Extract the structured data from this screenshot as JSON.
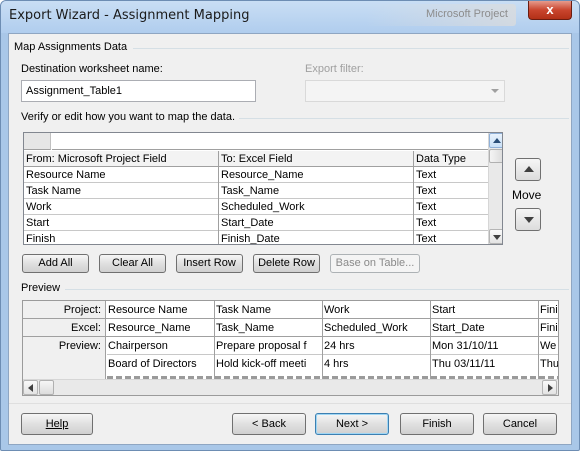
{
  "window": {
    "title": "Export Wizard - Assignment Mapping",
    "ghost_title": "Microsoft Project",
    "close_glyph": "x"
  },
  "map_section": {
    "title": "Map Assignments Data",
    "dest_label": "Destination worksheet name:",
    "dest_value": "Assignment_Table1",
    "filter_label": "Export filter:",
    "filter_value": ""
  },
  "mapping": {
    "instruction": "Verify or edit how you want to map the data.",
    "edit_value": "",
    "headers": [
      "From: Microsoft Project Field",
      "To:  Excel Field",
      "Data Type"
    ],
    "rows": [
      [
        "Resource Name",
        "Resource_Name",
        "Text"
      ],
      [
        "Task Name",
        "Task_Name",
        "Text"
      ],
      [
        "Work",
        "Scheduled_Work",
        "Text"
      ],
      [
        "Start",
        "Start_Date",
        "Text"
      ],
      [
        "Finish",
        "Finish_Date",
        "Text"
      ]
    ],
    "move_label": "Move"
  },
  "actions": {
    "add_all": "Add All",
    "clear_all": "Clear All",
    "insert_row": "Insert Row",
    "delete_row": "Delete Row",
    "base_on_table": "Base on Table..."
  },
  "preview": {
    "title": "Preview",
    "row_labels": [
      "Project:",
      "Excel:",
      "Preview:"
    ],
    "project_fields": [
      "Resource Name",
      "Task Name",
      "Work",
      "Start",
      "Fini"
    ],
    "excel_fields": [
      "Resource_Name",
      "Task_Name",
      "Scheduled_Work",
      "Start_Date",
      "Fini"
    ],
    "data_rows": [
      [
        "Chairperson",
        "Prepare proposal f",
        "24 hrs",
        "Mon 31/10/11",
        "We"
      ],
      [
        "Board of Directors",
        "Hold kick-off meeti",
        "4 hrs",
        "Thu 03/11/11",
        "Thu"
      ]
    ]
  },
  "footer": {
    "help": "Help",
    "back": "< Back",
    "next": "Next >",
    "finish": "Finish",
    "cancel": "Cancel"
  }
}
